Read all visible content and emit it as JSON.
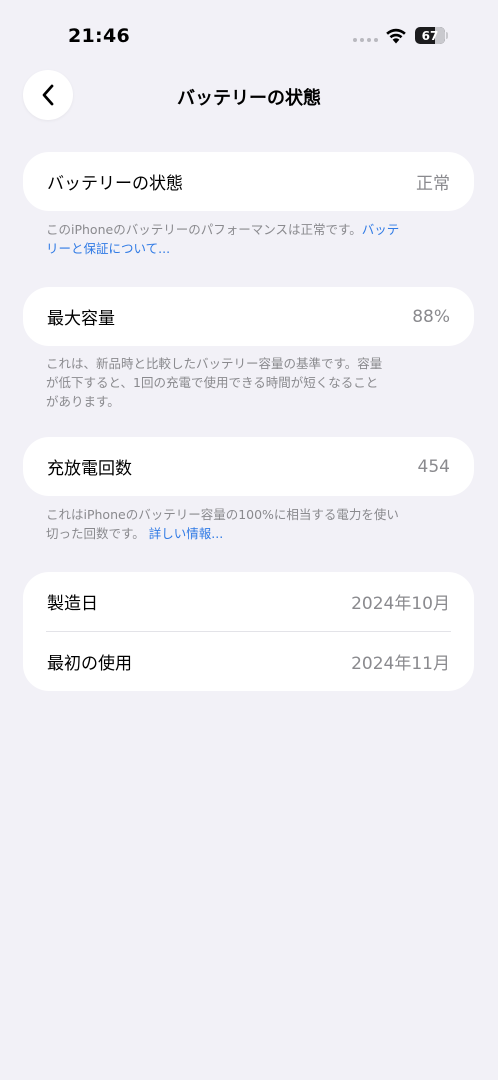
{
  "status_bar": {
    "time": "21:46",
    "battery_level": "67"
  },
  "nav": {
    "title": "バッテリーの状態"
  },
  "health": {
    "label": "バッテリーの状態",
    "value": "正常",
    "footnote_text": "このiPhoneのバッテリーのパフォーマンスは正常です。",
    "footnote_link_line1": "バッテ",
    "footnote_link_line2": "リーと保証について..."
  },
  "capacity": {
    "label": "最大容量",
    "value": "88%",
    "footnote_line1": "これは、新品時と比較したバッテリー容量の基準です。容量",
    "footnote_line2": "が低下すると、1回の充電で使用できる時間が短くなること",
    "footnote_line3": "があります。"
  },
  "cycles": {
    "label": "充放電回数",
    "value": "454",
    "footnote_line1": "これはiPhoneのバッテリー容量の100%に相当する電力を使い",
    "footnote_line2_text": "切った回数です。",
    "footnote_link": "詳しい情報..."
  },
  "dates": {
    "manufacture_label": "製造日",
    "manufacture_value": "2024年10月",
    "first_use_label": "最初の使用",
    "first_use_value": "2024年11月"
  }
}
